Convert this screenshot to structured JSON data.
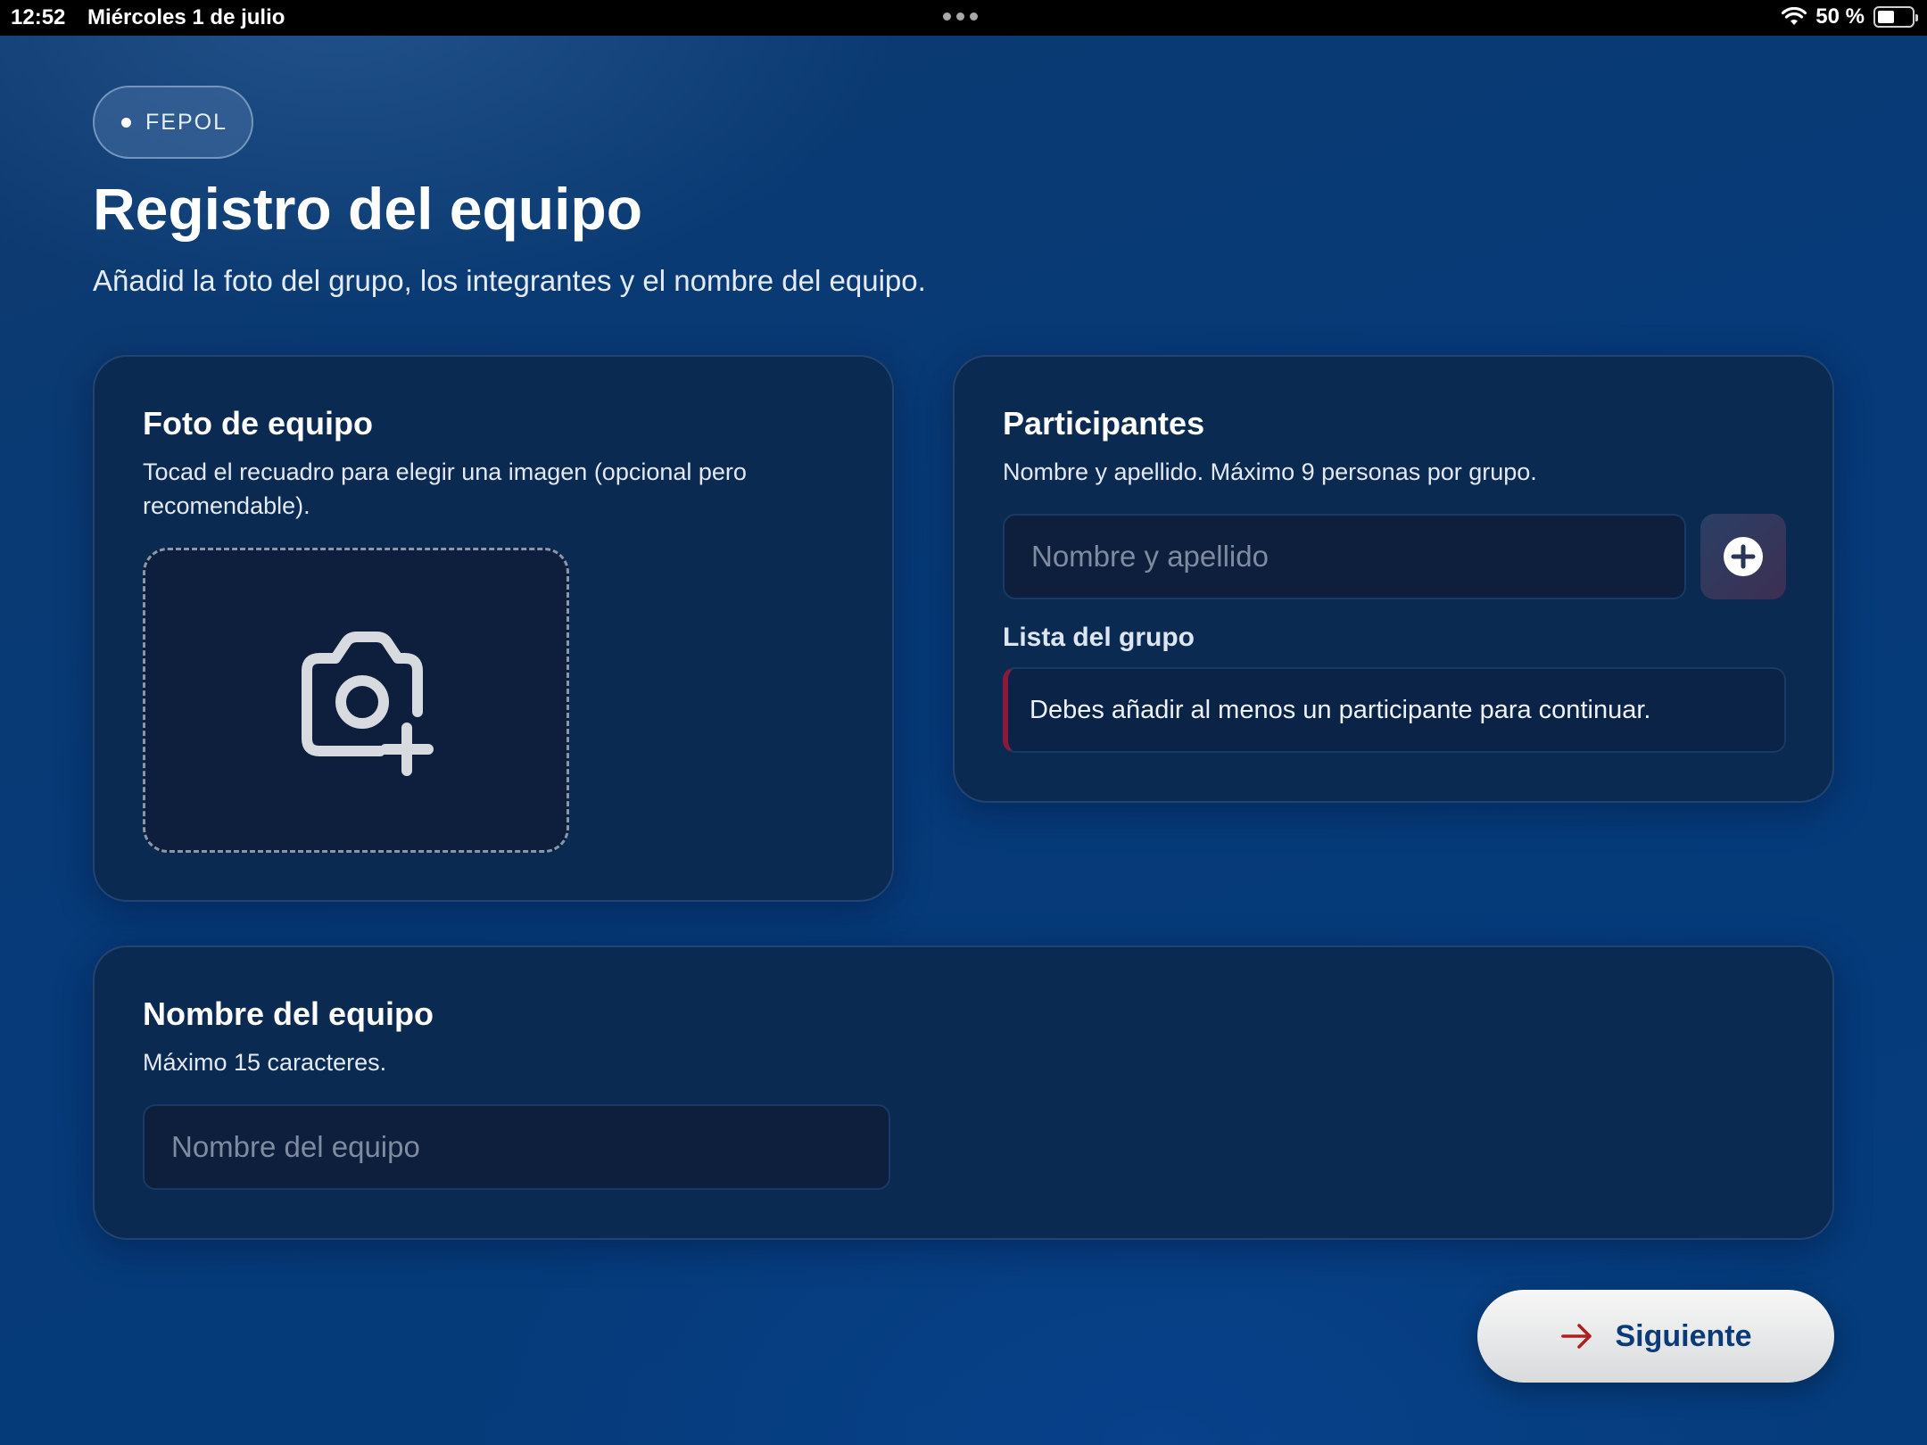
{
  "status_bar": {
    "time": "12:52",
    "date": "Miércoles 1 de julio",
    "battery": "50 %",
    "battery_level": 0.5,
    "wifi_icon": "wifi-icon",
    "battery_icon": "battery-icon"
  },
  "header": {
    "badge": "FEPOL",
    "title": "Registro del equipo",
    "subtitle": "Añadid la foto del grupo, los integrantes y el nombre del equipo."
  },
  "photo_card": {
    "title": "Foto de equipo",
    "description": "Tocad el recuadro para elegir una imagen (opcional pero recomendable).",
    "icon": "camera-plus-icon"
  },
  "participants_card": {
    "title": "Participantes",
    "description": "Nombre y apellido. Máximo 9 personas por grupo.",
    "input_placeholder": "Nombre y apellido",
    "input_value": "",
    "add_icon": "plus-circle-icon",
    "list_label": "Lista del grupo",
    "warning": "Debes añadir al menos un participante para continuar."
  },
  "team_name_card": {
    "title": "Nombre del equipo",
    "description": "Máximo 15 caracteres.",
    "input_placeholder": "Nombre del equipo",
    "input_value": ""
  },
  "next_button": {
    "label": "Siguiente",
    "icon": "arrow-right-icon"
  },
  "colors": {
    "accent_red": "#8b1a3a",
    "button_text": "#0a3a78",
    "card_bg": "#0b2a52"
  }
}
